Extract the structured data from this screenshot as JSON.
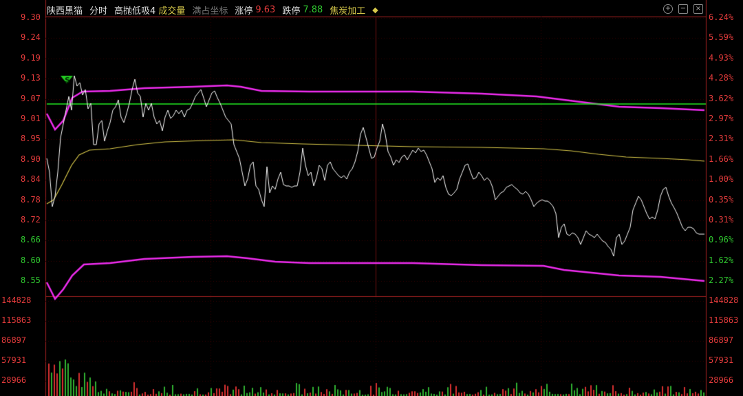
{
  "header": {
    "stock_name": "陕西黑猫",
    "mode": "分时",
    "indicator": "高抛低吸4",
    "volume_label": "成交量",
    "fullscreen_label": "满占坐标",
    "limit_up_label": "涨停",
    "limit_up_value": "9.63",
    "limit_down_label": "跌停",
    "limit_down_value": "7.88",
    "sector": "焦炭加工",
    "sector_icon": "diamond-toggle-icon"
  },
  "window_icons": [
    "plus-circle-icon",
    "minimize-icon",
    "close-icon"
  ],
  "price_axis": {
    "left": [
      "9.30",
      "9.24",
      "9.19",
      "9.13",
      "9.07",
      "9.01",
      "8.95",
      "8.90",
      "8.84",
      "8.78",
      "8.72",
      "8.66",
      "8.60",
      "8.55"
    ],
    "right": [
      "6.24%",
      "5.59%",
      "4.93%",
      "4.28%",
      "3.62%",
      "2.97%",
      "2.31%",
      "1.66%",
      "1.00%",
      "0.35%",
      "0.31%",
      "0.96%",
      "1.62%",
      "2.27%"
    ],
    "up_color": "#e23b3b",
    "down_color": "#2fc62f"
  },
  "volume_axis": {
    "ticks": [
      "144828",
      "115863",
      "86897",
      "57931",
      "28966"
    ]
  },
  "marker_text": "S",
  "colors": {
    "price_line": "#ffffff",
    "avg_line": "#d9c94a",
    "band": "#ee2cee",
    "signal_line": "#22ee22",
    "grid": "#3a0000",
    "axis": "#a02020"
  }
}
